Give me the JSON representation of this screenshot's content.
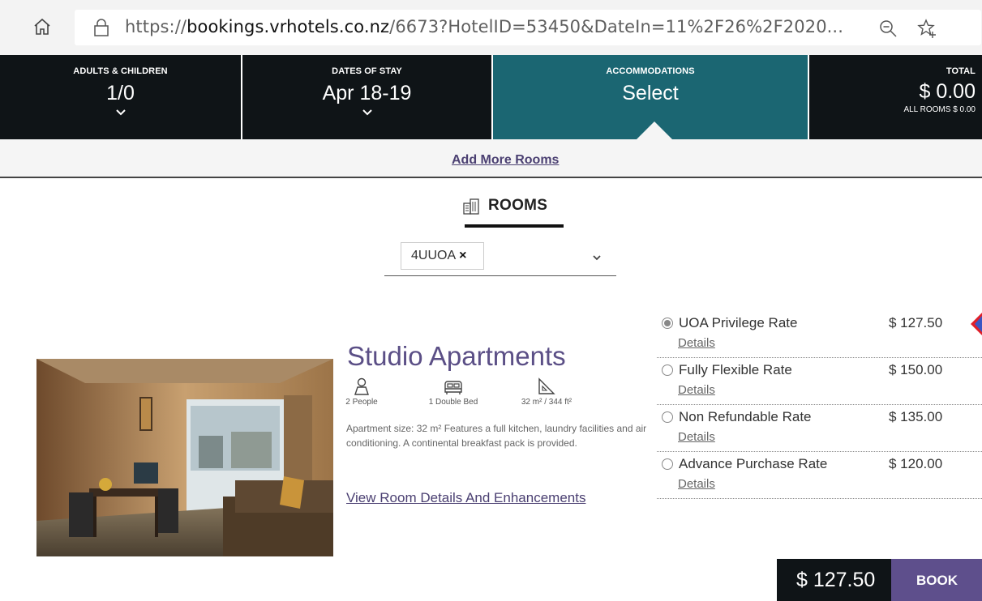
{
  "browser": {
    "url_scheme": "https://",
    "url_host": "bookings.vrhotels.co.nz",
    "url_rest": "/6673?HotelID=53450&DateIn=11%2F26%2F2020..."
  },
  "steps": {
    "guests": {
      "label": "ADULTS & CHILDREN",
      "value": "1/0"
    },
    "dates": {
      "label": "DATES OF STAY",
      "value": "Apr 18-19"
    },
    "accommodations": {
      "label": "ACCOMMODATIONS",
      "value": "Select"
    },
    "total": {
      "label": "TOTAL",
      "value": "$ 0.00",
      "sub": "ALL ROOMS $ 0.00"
    }
  },
  "add_more_rooms": "Add More Rooms",
  "rooms_heading": "ROOMS",
  "filter": {
    "chip": "4UUOA",
    "chip_remove": "×"
  },
  "room": {
    "name": "Studio Apartments",
    "features": {
      "people": "2 People",
      "bed": "1 Double Bed",
      "size": "32 m² / 344 ft²"
    },
    "description": "Apartment size: 32 m² Features a full kitchen, laundry facilities and air conditioning. A continental breakfast pack is provided.",
    "details_link": "View Room Details And Enhancements"
  },
  "rates": [
    {
      "name": "UOA Privilege Rate",
      "details": "Details",
      "price": "$ 127.50",
      "selected": true
    },
    {
      "name": "Fully Flexible Rate",
      "details": "Details",
      "price": "$ 150.00",
      "selected": false
    },
    {
      "name": "Non Refundable Rate",
      "details": "Details",
      "price": "$ 135.00",
      "selected": false
    },
    {
      "name": "Advance Purchase Rate",
      "details": "Details",
      "price": "$ 120.00",
      "selected": false
    }
  ],
  "book": {
    "price": "$ 127.50",
    "button": "BOOK"
  },
  "colors": {
    "header_dark": "#0f1417",
    "accommodations_teal": "#1b6672",
    "brand_purple": "#5e4f8c",
    "link_purple": "#4b4072",
    "marker_red": "#e0202a"
  }
}
